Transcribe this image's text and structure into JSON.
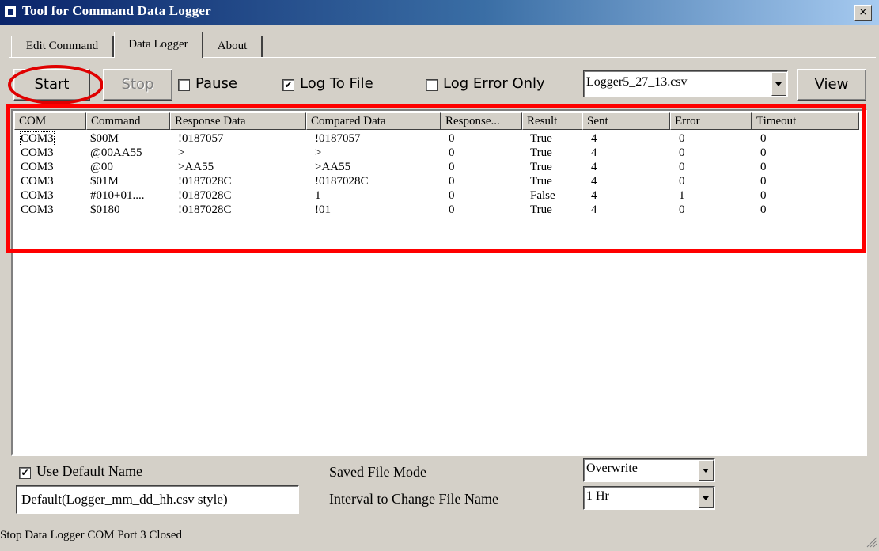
{
  "window": {
    "title": "Tool for Command Data Logger",
    "close_glyph": "×"
  },
  "tabs": [
    {
      "label": "Edit Command",
      "active": false
    },
    {
      "label": "Data Logger",
      "active": true
    },
    {
      "label": "About",
      "active": false
    }
  ],
  "toolbar": {
    "start_label": "Start",
    "stop_label": "Stop",
    "pause_label": "Pause",
    "pause_checked": false,
    "log_to_file_label": "Log To File",
    "log_to_file_checked": true,
    "log_error_only_label": "Log Error Only",
    "log_error_only_checked": false,
    "file_select_value": "Logger5_27_13.csv",
    "view_label": "View"
  },
  "table": {
    "columns": [
      "COM",
      "Command",
      "Response Data",
      "Compared Data",
      "Response...",
      "Result",
      "Sent",
      "Error",
      "Timeout"
    ],
    "rows": [
      [
        "COM3",
        "$00M",
        "!0187057",
        "!0187057",
        "0",
        "True",
        "4",
        "0",
        "0"
      ],
      [
        "COM3",
        "@00AA55",
        ">",
        ">",
        "0",
        "True",
        "4",
        "0",
        "0"
      ],
      [
        "COM3",
        "@00",
        ">AA55",
        ">AA55",
        "0",
        "True",
        "4",
        "0",
        "0"
      ],
      [
        "COM3",
        "$01M",
        "!0187028C",
        "!0187028C",
        "0",
        "True",
        "4",
        "0",
        "0"
      ],
      [
        "COM3",
        "#010+01....",
        "!0187028C",
        "1",
        "0",
        "False",
        "4",
        "1",
        "0"
      ],
      [
        "COM3",
        "$0180",
        "!0187028C",
        "!01",
        "0",
        "True",
        "4",
        "0",
        "0"
      ]
    ]
  },
  "footer": {
    "use_default_name_label": "Use Default Name",
    "use_default_name_checked": true,
    "default_name_value": "Default(Logger_mm_dd_hh.csv style)",
    "saved_file_mode_label": "Saved File Mode",
    "saved_file_mode_value": "Overwrite",
    "interval_label": "Interval to Change File Name",
    "interval_value": "1 Hr"
  },
  "status": {
    "text": "Stop Data Logger COM Port 3 Closed"
  },
  "colors": {
    "titlebar_start": "#0a246a",
    "titlebar_end": "#a6caf0",
    "face": "#d4d0c8",
    "annotation_red": "#ff0000"
  },
  "check_glyph": "✔"
}
